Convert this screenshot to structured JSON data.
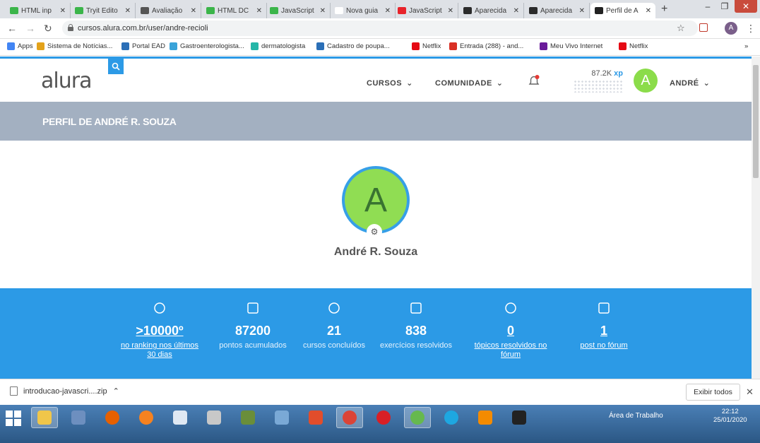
{
  "browser": {
    "tabs": [
      {
        "label": "HTML inp",
        "color": "#3bb54a"
      },
      {
        "label": "Tryit Edito",
        "color": "#3bb54a"
      },
      {
        "label": "Avaliação",
        "color": "#555555"
      },
      {
        "label": "HTML DC",
        "color": "#3bb54a"
      },
      {
        "label": "JavaScript",
        "color": "#3bb54a"
      },
      {
        "label": "Nova guia",
        "color": "#ffffff"
      },
      {
        "label": "JavaScript",
        "color": "#e8232a"
      },
      {
        "label": "Aparecida",
        "color": "#2b2b2b"
      },
      {
        "label": "Aparecida",
        "color": "#2b2b2b"
      },
      {
        "label": "Perfil de A",
        "color": "#222222"
      }
    ],
    "new_tab": "+",
    "url": "cursos.alura.com.br/user/andre-recioli",
    "bookmarks": [
      {
        "label": "Apps",
        "color": "#4285f4"
      },
      {
        "label": "Sistema de Notícias...",
        "color": "#e3a21a"
      },
      {
        "label": "Portal EAD",
        "color": "#2b6fb7"
      },
      {
        "label": "Gastroenterologista...",
        "color": "#3aa3d9"
      },
      {
        "label": "dermatologista",
        "color": "#25b6a8"
      },
      {
        "label": "Cadastro de poupa...",
        "color": "#2b6fb7"
      },
      {
        "label": "Netflix",
        "color": "#e50914"
      },
      {
        "label": "Entrada (288) - and...",
        "color": "#d93025"
      },
      {
        "label": "Meu Vivo Internet",
        "color": "#6a1b9a"
      },
      {
        "label": "Netflix",
        "color": "#e50914"
      }
    ],
    "more_bookmarks": "»"
  },
  "site": {
    "logo": "alura",
    "menu": [
      {
        "label": "CURSOS"
      },
      {
        "label": "COMUNIDADE"
      }
    ],
    "xp_value": "87.2K",
    "xp_unit": "xp",
    "avatar_letter": "A",
    "user_label": "ANDRÉ",
    "profile_title": "PERFIL DE ANDRÉ R. SOUZA",
    "full_name": "André R. Souza",
    "stats": [
      {
        "icon": "activity-icon",
        "value": ">10000º",
        "label": "no ranking nos últimos 30 dias",
        "link": true
      },
      {
        "icon": "coins-icon",
        "value": "87200",
        "label": "pontos acumulados",
        "link": false
      },
      {
        "icon": "graduation-cap-icon",
        "value": "21",
        "label": "cursos concluídos",
        "link": false
      },
      {
        "icon": "clipboard-icon",
        "value": "838",
        "label": "exercícios resolvidos",
        "link": false
      },
      {
        "icon": "handshake-icon",
        "value": "0",
        "label": "tópicos resolvidos no fórum",
        "link": true
      },
      {
        "icon": "forum-post-icon",
        "value": "1",
        "label": "post no fórum",
        "link": true
      }
    ]
  },
  "downloads": {
    "file": "introducao-javascri....zip",
    "show_all": "Exibir todos",
    "close": "✕"
  },
  "taskbar": {
    "desktop_label": "Área de Trabalho",
    "time": "22:12",
    "date": "25/01/2020",
    "apps": [
      {
        "name": "file-explorer",
        "color": "#f0c64a",
        "active": true
      },
      {
        "name": "network-tool",
        "color": "#6d8fbf",
        "active": false
      },
      {
        "name": "firefox",
        "color": "#e66000",
        "active": false
      },
      {
        "name": "avast",
        "color": "#f58220",
        "active": false
      },
      {
        "name": "window-app",
        "color": "#dfe8f3",
        "active": false
      },
      {
        "name": "tool-app",
        "color": "#c8c8c8",
        "active": false
      },
      {
        "name": "terminal-app",
        "color": "#6a8e3a",
        "active": false
      },
      {
        "name": "notepad",
        "color": "#7aa9d6",
        "active": false
      },
      {
        "name": "media-app",
        "color": "#e24d2b",
        "active": false
      },
      {
        "name": "chrome",
        "color": "#db4437",
        "active": true
      },
      {
        "name": "flash",
        "color": "#d81f26",
        "active": false
      },
      {
        "name": "atom",
        "color": "#66b94e",
        "active": true
      },
      {
        "name": "internet-explorer",
        "color": "#1ea7e1",
        "active": false
      },
      {
        "name": "vlc",
        "color": "#f48b00",
        "active": false
      },
      {
        "name": "cmd",
        "color": "#222222",
        "active": false
      }
    ]
  }
}
